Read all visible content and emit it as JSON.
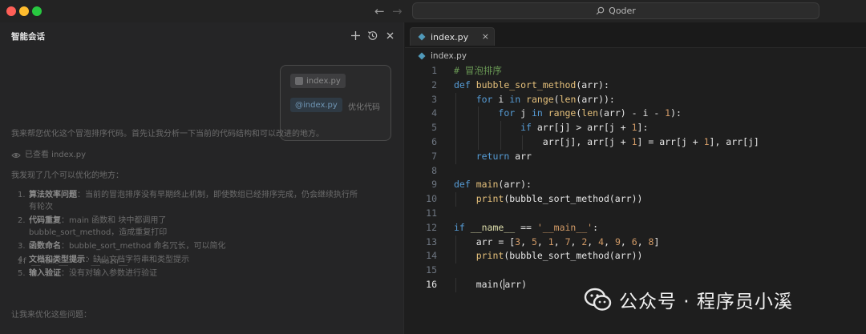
{
  "titlebar": {
    "search_text": "Qoder",
    "back_arrow": "←",
    "forward_arrow": "→"
  },
  "chat": {
    "title": "智能会话",
    "user_message": {
      "attached_file": "index.py",
      "mention": "@index.py",
      "text": "优化代码"
    },
    "intro": "我来帮您优化这个冒泡排序代码。首先让我分析一下当前的代码结构和可以改进的地方。",
    "viewed_label": "已查看 index.py",
    "found_text": "我发现了几个可以优化的地方：",
    "issues": [
      {
        "num": "1.",
        "title": "算法效率问题",
        "desc_1": "：当前的冒泡排序没有早期终止机制，即使数组已经排序完成，仍会继续执行所",
        "desc_2": "有轮次"
      },
      {
        "num": "2.",
        "title": "代码重复",
        "desc_1": "：main 函数和 ",
        "code": "if __name__ == '__main__'",
        "desc_1b": " 块中都调用了",
        "desc_2": "bubble_sort_method，造成重复打印"
      },
      {
        "num": "3.",
        "title": "函数命名",
        "desc_1": "：bubble_sort_method 命名冗长，可以简化"
      },
      {
        "num": "4.",
        "title": "文档和类型提示",
        "desc_1": "：缺少文档字符串和类型提示"
      },
      {
        "num": "5.",
        "title": "输入验证",
        "desc_1": "：没有对输入参数进行验证"
      }
    ],
    "closing": "让我来优化这些问题："
  },
  "editor": {
    "tab_label": "index.py",
    "tab_close": "×",
    "breadcrumb": "index.py",
    "active_line": 16,
    "line_numbers": [
      "1",
      "2",
      "3",
      "4",
      "5",
      "6",
      "7",
      "8",
      "9",
      "10",
      "11",
      "12",
      "13",
      "14",
      "15",
      "16"
    ],
    "lines": [
      {
        "t": [
          [
            "cm",
            "# 冒泡排序"
          ]
        ]
      },
      {
        "t": [
          [
            "kw",
            "def "
          ],
          [
            "fn",
            "bubble_sort_method"
          ],
          [
            "",
            "(arr):"
          ]
        ]
      },
      {
        "t": [
          [
            "",
            "    "
          ],
          [
            "kw",
            "for "
          ],
          [
            "",
            "i "
          ],
          [
            "kw",
            "in "
          ],
          [
            "bi",
            "range"
          ],
          [
            "",
            "("
          ],
          [
            "bi",
            "len"
          ],
          [
            "",
            "(arr)):"
          ]
        ]
      },
      {
        "t": [
          [
            "",
            "        "
          ],
          [
            "kw",
            "for "
          ],
          [
            "",
            "j "
          ],
          [
            "kw",
            "in "
          ],
          [
            "bi",
            "range"
          ],
          [
            "",
            "("
          ],
          [
            "bi",
            "len"
          ],
          [
            "",
            "(arr) - i - "
          ],
          [
            "nm",
            "1"
          ],
          [
            "",
            "):"
          ]
        ]
      },
      {
        "t": [
          [
            "",
            "            "
          ],
          [
            "kw",
            "if "
          ],
          [
            "",
            "arr[j] > arr[j + "
          ],
          [
            "nm",
            "1"
          ],
          [
            "",
            "]:"
          ]
        ]
      },
      {
        "t": [
          [
            "",
            "                arr[j], arr[j + "
          ],
          [
            "nm",
            "1"
          ],
          [
            "",
            "] = arr[j + "
          ],
          [
            "nm",
            "1"
          ],
          [
            "",
            "], arr[j]"
          ]
        ]
      },
      {
        "t": [
          [
            "",
            "    "
          ],
          [
            "kw",
            "return "
          ],
          [
            "",
            "arr"
          ]
        ]
      },
      {
        "t": [
          [
            "",
            ""
          ]
        ]
      },
      {
        "t": [
          [
            "kw",
            "def "
          ],
          [
            "fn",
            "main"
          ],
          [
            "",
            "(arr):"
          ]
        ]
      },
      {
        "t": [
          [
            "",
            "    "
          ],
          [
            "bi",
            "print"
          ],
          [
            "",
            "(bubble_sort_method(arr))"
          ]
        ]
      },
      {
        "t": [
          [
            "",
            ""
          ]
        ]
      },
      {
        "t": [
          [
            "kw",
            "if "
          ],
          [
            "dn",
            "__name__"
          ],
          [
            "",
            " == "
          ],
          [
            "st",
            "'__main__'"
          ],
          [
            "",
            ":"
          ]
        ]
      },
      {
        "t": [
          [
            "",
            "    arr = ["
          ],
          [
            "nm",
            "3"
          ],
          [
            "",
            ", "
          ],
          [
            "nm",
            "5"
          ],
          [
            "",
            ", "
          ],
          [
            "nm",
            "1"
          ],
          [
            "",
            ", "
          ],
          [
            "nm",
            "7"
          ],
          [
            "",
            ", "
          ],
          [
            "nm",
            "2"
          ],
          [
            "",
            ", "
          ],
          [
            "nm",
            "4"
          ],
          [
            "",
            ", "
          ],
          [
            "nm",
            "9"
          ],
          [
            "",
            ", "
          ],
          [
            "nm",
            "6"
          ],
          [
            "",
            ", "
          ],
          [
            "nm",
            "8"
          ],
          [
            "",
            "]"
          ]
        ]
      },
      {
        "t": [
          [
            "",
            "    "
          ],
          [
            "bi",
            "print"
          ],
          [
            "",
            "(bubble_sort_method(arr))"
          ]
        ]
      },
      {
        "t": [
          [
            "",
            ""
          ]
        ]
      },
      {
        "t": [
          [
            "",
            "    main("
          ],
          [
            "cursor",
            ""
          ],
          [
            "",
            "arr)"
          ]
        ]
      }
    ]
  },
  "watermark": {
    "text": "公众号 · 程序员小溪"
  },
  "colors": {
    "keyword": "#569cd6",
    "function": "#e5c07b",
    "comment": "#6a9955",
    "string": "#d19a66",
    "python_icon": "#519aba"
  },
  "icons": {
    "search": "search-icon",
    "plus": "plus-icon",
    "history": "history-icon",
    "close": "close-icon",
    "eye": "eye-icon",
    "python": "python-file-icon",
    "wechat": "wechat-logo"
  }
}
